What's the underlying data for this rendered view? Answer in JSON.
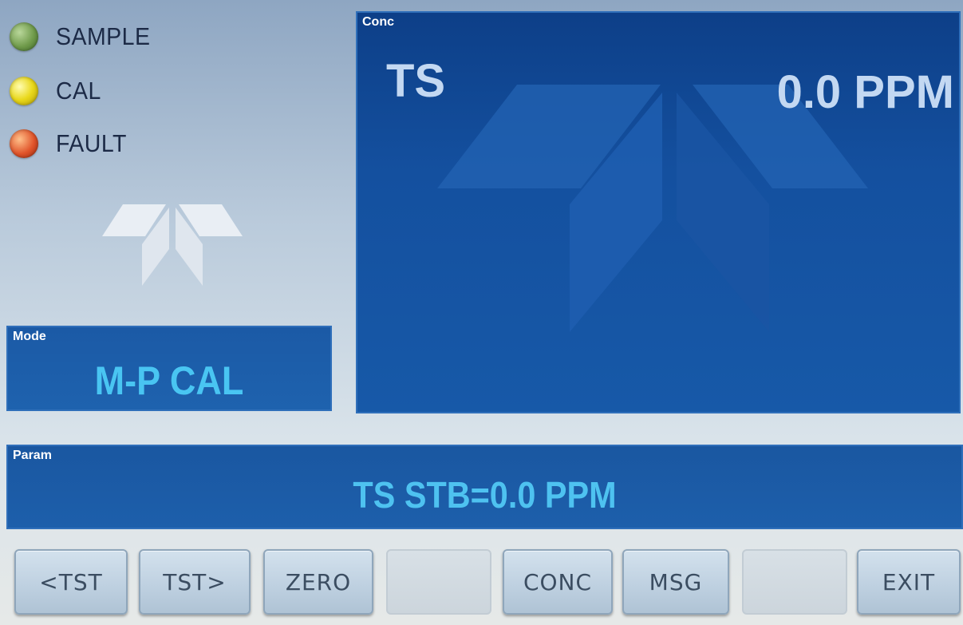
{
  "indicators": [
    {
      "label": "SAMPLE",
      "color": "#6f9a4a"
    },
    {
      "label": "CAL",
      "color": "#e9d81a"
    },
    {
      "label": "FAULT",
      "color": "#e0542a"
    }
  ],
  "mode": {
    "tag": "Mode",
    "value": "M-P CAL"
  },
  "conc": {
    "tag": "Conc",
    "name": "TS",
    "value": "0.0 PPM"
  },
  "param": {
    "tag": "Param",
    "value": "TS STB=0.0 PPM"
  },
  "buttons": {
    "b1": "<TST",
    "b2": "TST>",
    "b3": "ZERO",
    "b4": "",
    "b5": "CONC",
    "b6": "MSG",
    "b7": "",
    "b8": "EXIT"
  },
  "colors": {
    "panel_blue": "#1d5da8",
    "value_cyan": "#49c5f2",
    "conc_text": "#c3d8f2"
  },
  "icons": {
    "logo": "teledyne-logo-icon"
  }
}
